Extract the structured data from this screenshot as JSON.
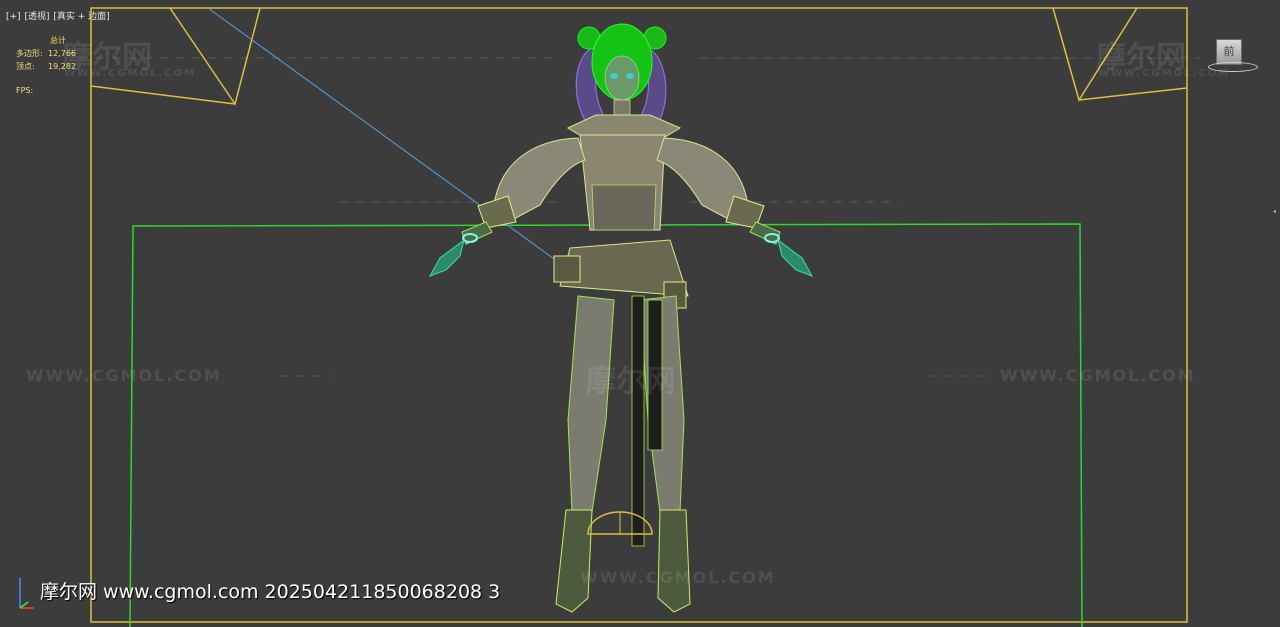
{
  "viewport": {
    "label_plus": "[+]",
    "label_view": "[透视]",
    "label_shading": "[真实 + 边面]",
    "stats_heading": "总计",
    "stats": [
      {
        "label": "多边形:",
        "value": "12,766"
      },
      {
        "label": "顶点:",
        "value": "19,282"
      }
    ],
    "fps_label": "FPS:",
    "viewcube_face": "前"
  },
  "watermark": {
    "logo": "摩尔网",
    "url": "WWW.CGMOL.COM"
  },
  "caption": "摩尔网 www.cgmol.com 202504211850068208 3",
  "icons": [
    "axis-gizmo-icon",
    "viewcube-icon"
  ],
  "colors": {
    "background": "#3c3c3c",
    "frame_yellow": "#d9c23a",
    "frame_green": "#2fd62f",
    "wire_green": "#9ee84a",
    "hair_green": "#14d414",
    "hair_purple": "#8a72d8",
    "camera_line": "#5aa0d8",
    "stats_text": "#f0e070"
  }
}
